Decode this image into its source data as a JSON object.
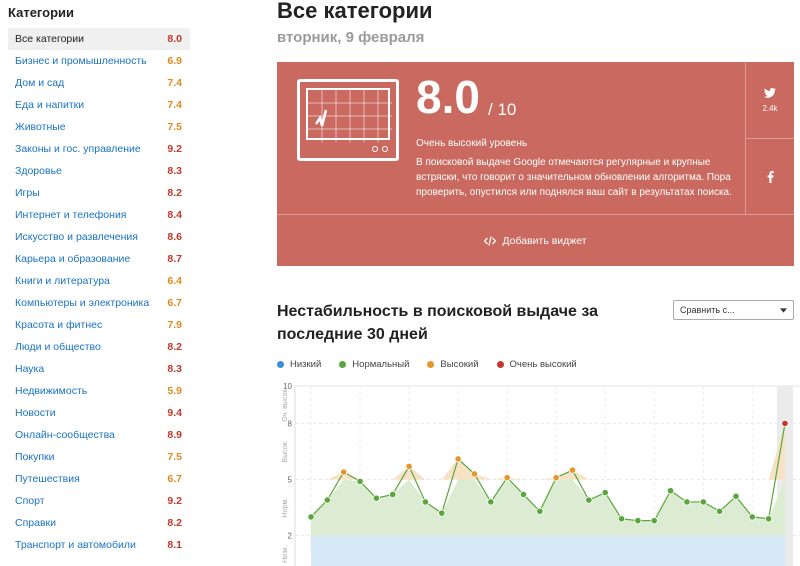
{
  "sidebar": {
    "title": "Категории",
    "items": [
      {
        "label": "Все категории",
        "score": "8.0",
        "level": "red",
        "active": true
      },
      {
        "label": "Бизнес и промышленность",
        "score": "6.9",
        "level": "orange"
      },
      {
        "label": "Дом и сад",
        "score": "7.4",
        "level": "orange"
      },
      {
        "label": "Еда и напитки",
        "score": "7.4",
        "level": "orange"
      },
      {
        "label": "Животные",
        "score": "7.5",
        "level": "orange"
      },
      {
        "label": "Законы и гос. управление",
        "score": "9.2",
        "level": "red"
      },
      {
        "label": "Здоровье",
        "score": "8.3",
        "level": "red"
      },
      {
        "label": "Игры",
        "score": "8.2",
        "level": "red"
      },
      {
        "label": "Интернет и телефония",
        "score": "8.4",
        "level": "red"
      },
      {
        "label": "Искусство и развлечения",
        "score": "8.6",
        "level": "red"
      },
      {
        "label": "Карьера и образование",
        "score": "8.7",
        "level": "red"
      },
      {
        "label": "Книги и литература",
        "score": "6.4",
        "level": "orange"
      },
      {
        "label": "Компьютеры и электроника",
        "score": "6.7",
        "level": "orange"
      },
      {
        "label": "Красота и фитнес",
        "score": "7.9",
        "level": "orange"
      },
      {
        "label": "Люди и общество",
        "score": "8.2",
        "level": "red"
      },
      {
        "label": "Наука",
        "score": "8.3",
        "level": "red"
      },
      {
        "label": "Недвижимость",
        "score": "5.9",
        "level": "orange"
      },
      {
        "label": "Новости",
        "score": "9.4",
        "level": "red"
      },
      {
        "label": "Онлайн-сообщества",
        "score": "8.9",
        "level": "red"
      },
      {
        "label": "Покупки",
        "score": "7.5",
        "level": "orange"
      },
      {
        "label": "Путешествия",
        "score": "6.7",
        "level": "orange"
      },
      {
        "label": "Спорт",
        "score": "9.2",
        "level": "red"
      },
      {
        "label": "Справки",
        "score": "8.2",
        "level": "red"
      },
      {
        "label": "Транспорт и автомобили",
        "score": "8.1",
        "level": "red"
      }
    ]
  },
  "header": {
    "title": "Все категории",
    "date": "вторник, 9 февраля"
  },
  "card": {
    "score": "8.0",
    "max": "/ 10",
    "level_label": "Очень высокий уровень",
    "description": "В поисковой выдаче Google отмечаются регулярные и крупные встряски, что говорит о значительном обновлении алгоритма. Пора проверить, опустился или поднялся ваш сайт в результатах поиска.",
    "twitter_count": "2.4k",
    "widget_label": "Добавить виджет",
    "icons": {
      "twitter": "twitter-icon",
      "facebook": "facebook-icon",
      "code": "code-icon",
      "monitor": "monitor-icon"
    }
  },
  "chart_section": {
    "title": "Нестабильность в поисковой выдаче за последние 30 дней",
    "compare_placeholder": "Сравнить с...",
    "legend": [
      {
        "label": "Низкий",
        "color": "#3b8fd4"
      },
      {
        "label": "Нормальный",
        "color": "#5aa63c"
      },
      {
        "label": "Высокий",
        "color": "#e6952b"
      },
      {
        "label": "Очень высокий",
        "color": "#c0392b"
      }
    ]
  },
  "chart_data": {
    "type": "area",
    "x": [
      1,
      2,
      3,
      4,
      5,
      6,
      7,
      8,
      9,
      10,
      11,
      12,
      13,
      14,
      15,
      16,
      17,
      18,
      19,
      20,
      21,
      22,
      23,
      24,
      25,
      26,
      27,
      28,
      29,
      30
    ],
    "series": [
      {
        "values": [
          3.0,
          3.9,
          5.4,
          4.9,
          4.0,
          4.2,
          5.7,
          3.8,
          3.2,
          6.1,
          5.3,
          3.8,
          5.1,
          4.2,
          3.3,
          5.1,
          5.5,
          3.9,
          4.3,
          2.9,
          2.8,
          2.8,
          4.4,
          3.8,
          3.8,
          3.3,
          4.1,
          3.0,
          2.9,
          8.0
        ]
      }
    ],
    "zones": [
      {
        "label": "Низк.",
        "from": 0,
        "to": 2,
        "color": "#3b8fd4"
      },
      {
        "label": "Норм.",
        "from": 2,
        "to": 5,
        "color": "#5aa63c"
      },
      {
        "label": "Высок.",
        "from": 5,
        "to": 8,
        "color": "#e6952b"
      },
      {
        "label": "Оч. высок.",
        "from": 8,
        "to": 10,
        "color": "#c0392b"
      }
    ],
    "y_ticks": [
      "10",
      "8",
      "5",
      "2"
    ],
    "ylim": [
      0,
      10
    ]
  }
}
